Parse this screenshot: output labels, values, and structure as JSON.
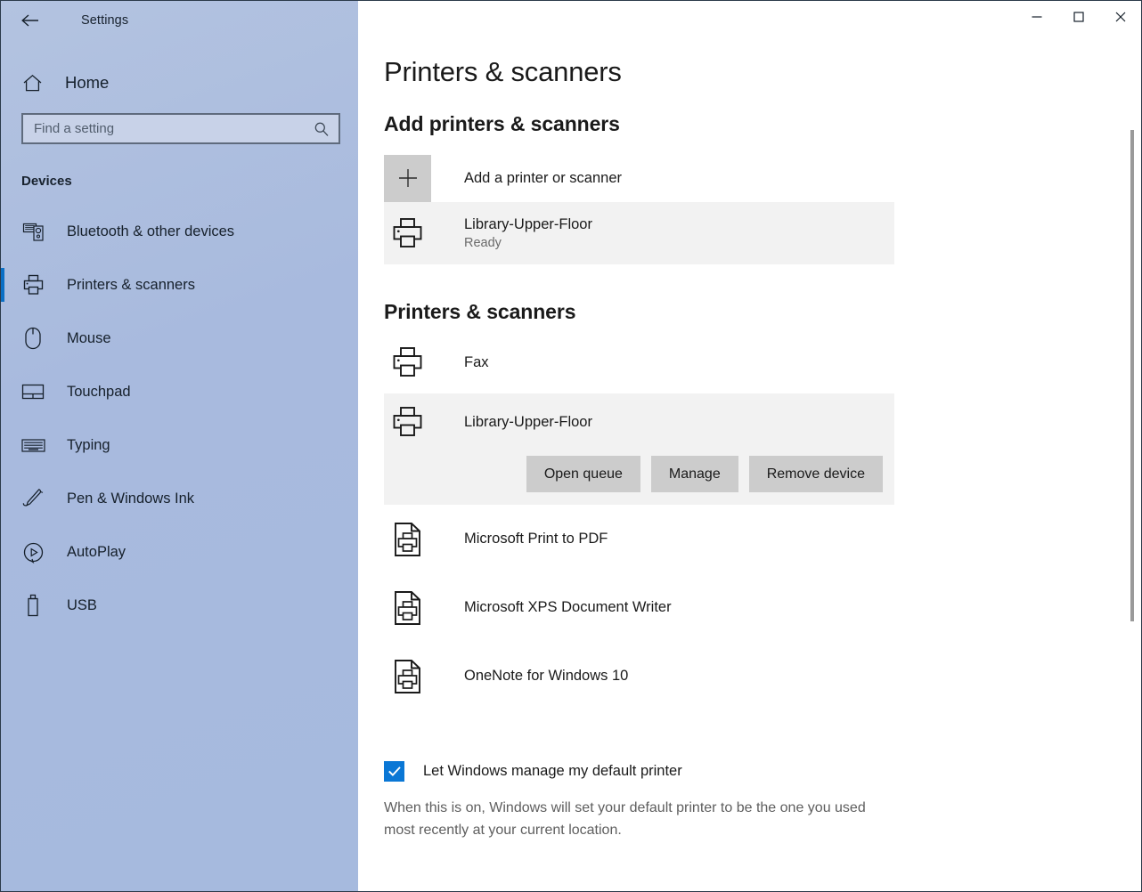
{
  "window": {
    "app_title": "Settings",
    "back_label": "Back",
    "controls": {
      "minimize": "Minimize",
      "maximize": "Maximize",
      "close": "Close"
    }
  },
  "sidebar": {
    "home_label": "Home",
    "search": {
      "placeholder": "Find a setting",
      "value": ""
    },
    "category": "Devices",
    "items": [
      {
        "label": "Bluetooth & other devices",
        "icon": "bluetooth-devices-icon",
        "selected": false
      },
      {
        "label": "Printers & scanners",
        "icon": "printer-icon",
        "selected": true
      },
      {
        "label": "Mouse",
        "icon": "mouse-icon",
        "selected": false
      },
      {
        "label": "Touchpad",
        "icon": "touchpad-icon",
        "selected": false
      },
      {
        "label": "Typing",
        "icon": "keyboard-icon",
        "selected": false
      },
      {
        "label": "Pen & Windows Ink",
        "icon": "pen-icon",
        "selected": false
      },
      {
        "label": "AutoPlay",
        "icon": "autoplay-icon",
        "selected": false
      },
      {
        "label": "USB",
        "icon": "usb-icon",
        "selected": false
      }
    ]
  },
  "main": {
    "page_title": "Printers & scanners",
    "add_section": {
      "heading": "Add printers & scanners",
      "add_button_label": "Add a printer or scanner",
      "found_device": {
        "name": "Library-Upper-Floor",
        "status": "Ready"
      }
    },
    "devices_section": {
      "heading": "Printers & scanners",
      "items": [
        {
          "name": "Fax",
          "icon": "printer-icon",
          "expanded": false,
          "highlighted": false
        },
        {
          "name": "Library-Upper-Floor",
          "icon": "printer-icon",
          "expanded": true,
          "highlighted": true
        },
        {
          "name": "Microsoft Print to PDF",
          "icon": "document-printer-icon",
          "expanded": false,
          "highlighted": false
        },
        {
          "name": "Microsoft XPS Document Writer",
          "icon": "document-printer-icon",
          "expanded": false,
          "highlighted": false
        },
        {
          "name": "OneNote for Windows 10",
          "icon": "document-printer-icon",
          "expanded": false,
          "highlighted": false
        }
      ],
      "actions": {
        "open_queue": "Open queue",
        "manage": "Manage",
        "remove_device": "Remove device"
      }
    },
    "default_printer": {
      "checkbox_label": "Let Windows manage my default printer",
      "checked": true,
      "description": "When this is on, Windows will set your default printer to be the one you used most recently at your current location."
    }
  },
  "colors": {
    "accent": "#0b6fc4",
    "checkbox": "#0a77d5",
    "sidebar_bg": "#a8bade",
    "row_highlight": "#f2f2f2",
    "button_bg": "#cccccc"
  }
}
